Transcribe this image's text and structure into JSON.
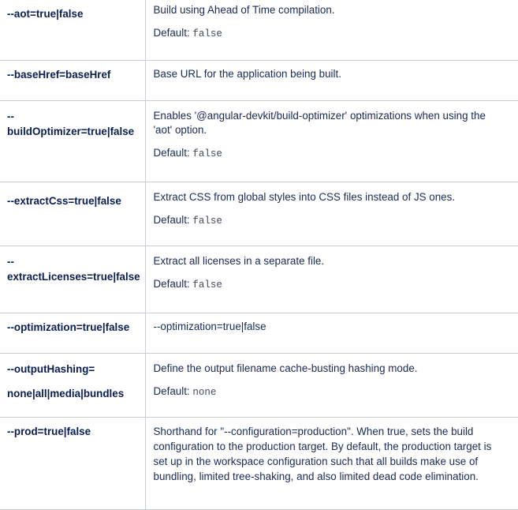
{
  "rows": [
    {
      "option_lines": [
        "--aot=true|false"
      ],
      "description": [
        "Build using Ahead of Time compilation."
      ],
      "default_label": "Default:",
      "default_value": "false"
    },
    {
      "option_lines": [
        "--baseHref=baseHref"
      ],
      "description": [
        "Base URL for the application being built."
      ]
    },
    {
      "option_lines": [
        "--",
        "buildOptimizer=true|false"
      ],
      "description": [
        "Enables '@angular-devkit/build-optimizer' optimizations when using the",
        "'aot' option."
      ],
      "default_label": "Default:",
      "default_value": "false"
    },
    {
      "option_lines": [
        "--extractCss=true|false"
      ],
      "description": [
        "Extract CSS from global styles into CSS files instead of JS ones."
      ],
      "default_label": "Default:",
      "default_value": "false"
    },
    {
      "option_lines": [
        "--",
        "extractLicenses=true|false"
      ],
      "description": [
        "Extract all licenses in a separate file."
      ],
      "default_label": "Default:",
      "default_value": "false"
    },
    {
      "option_lines": [
        "--optimization=true|false"
      ],
      "description": [
        "--optimization=true|false"
      ]
    },
    {
      "option_lines": [
        "--outputHashing=",
        "none|all|media|bundles"
      ],
      "description": [
        "Define the output filename cache-busting hashing mode."
      ],
      "default_label": "Default:",
      "default_value": "none"
    },
    {
      "option_lines": [
        "--prod=true|false"
      ],
      "description": [
        "Shorthand for \"--configuration=production\". When true, sets the build",
        "configuration to the production target. By default, the production target is",
        "set up in the workspace configuration such that all builds make use of",
        "bundling, limited tree-shaking, and also limited dead code elimination."
      ]
    }
  ]
}
